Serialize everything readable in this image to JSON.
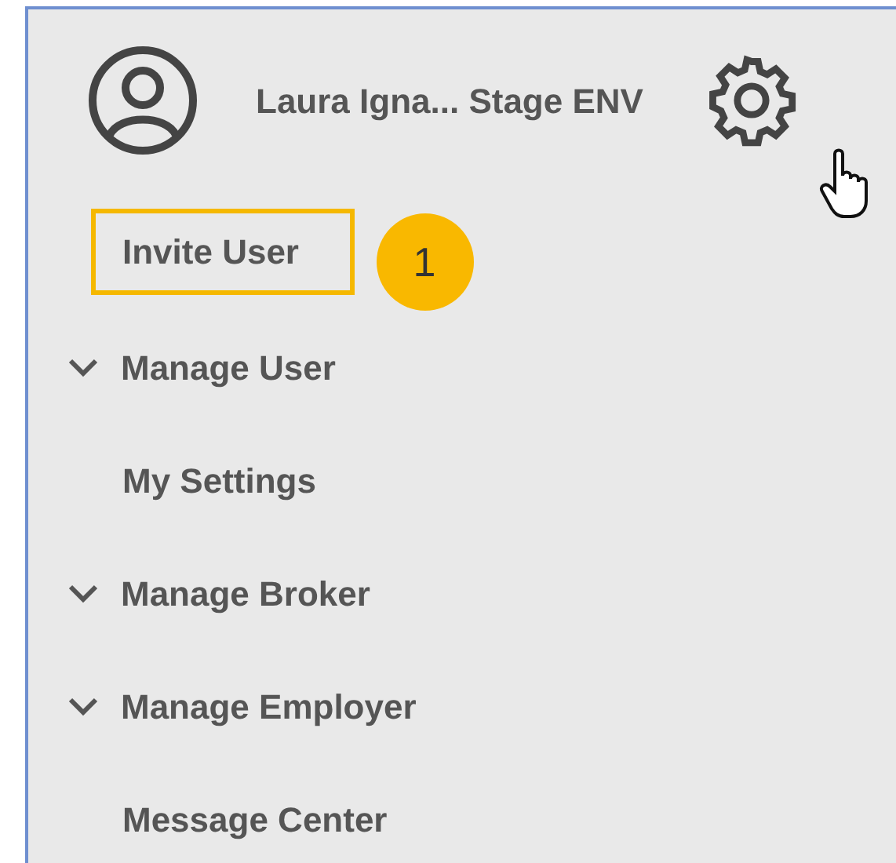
{
  "header": {
    "user_name": "Laura Igna... Stage ENV"
  },
  "callout": {
    "label": "1"
  },
  "menu": [
    {
      "label": "Invite User",
      "kind": "link",
      "highlighted": true
    },
    {
      "label": "Manage User",
      "kind": "group",
      "highlighted": false
    },
    {
      "label": "My Settings",
      "kind": "link",
      "highlighted": false
    },
    {
      "label": "Manage Broker",
      "kind": "group",
      "highlighted": false
    },
    {
      "label": "Manage Employer",
      "kind": "group",
      "highlighted": false
    },
    {
      "label": "Message Center",
      "kind": "link",
      "highlighted": false
    }
  ]
}
